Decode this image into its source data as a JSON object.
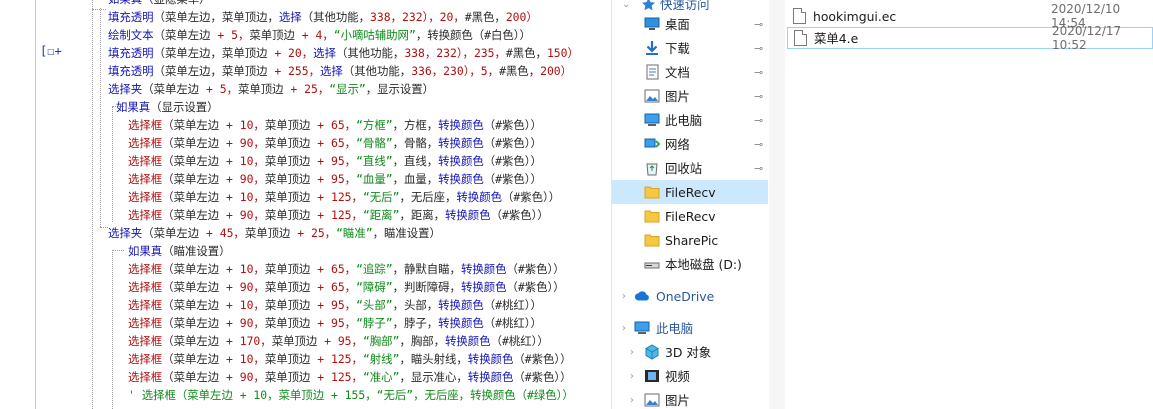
{
  "editor": {
    "breakpoint_marker": "[☐+",
    "lines": [
      [
        {
          "t": "如果真（",
          "c": "c-blue"
        },
        {
          "t": "显隐菜单）",
          "c": "c-dark"
        }
      ],
      [
        {
          "t": "填充透明",
          "c": "c-blue"
        },
        {
          "t": "（菜单左边，菜单顶边，",
          "c": "c-dark"
        },
        {
          "t": "选择",
          "c": "c-blue"
        },
        {
          "t": "（其他功能，",
          "c": "c-dark"
        },
        {
          "t": "338，232），20，",
          "c": "c-red"
        },
        {
          "t": "#黑色，",
          "c": "c-dark"
        },
        {
          "t": "200）",
          "c": "c-red"
        }
      ],
      [
        {
          "t": "绘制文本",
          "c": "c-blue"
        },
        {
          "t": "（菜单左边 ",
          "c": "c-dark"
        },
        {
          "t": "+ 5，",
          "c": "c-red"
        },
        {
          "t": "菜单顶边 ",
          "c": "c-dark"
        },
        {
          "t": "+ 4，",
          "c": "c-red"
        },
        {
          "t": "“小嘀咕辅助网”",
          "c": "c-green"
        },
        {
          "t": "，转换颜色（",
          "c": "c-dark"
        },
        {
          "t": "#白色））",
          "c": "c-dark"
        }
      ],
      [
        {
          "t": "填充透明",
          "c": "c-blue"
        },
        {
          "t": "（菜单左边，菜单顶边 ",
          "c": "c-dark"
        },
        {
          "t": "+ 20，",
          "c": "c-red"
        },
        {
          "t": "选择",
          "c": "c-blue"
        },
        {
          "t": "（其他功能，",
          "c": "c-dark"
        },
        {
          "t": "338，232），235，",
          "c": "c-red"
        },
        {
          "t": "#黑色，",
          "c": "c-dark"
        },
        {
          "t": "150）",
          "c": "c-red"
        }
      ],
      [
        {
          "t": "填充透明",
          "c": "c-blue"
        },
        {
          "t": "（菜单左边，菜单顶边 ",
          "c": "c-dark"
        },
        {
          "t": "+ 255，",
          "c": "c-red"
        },
        {
          "t": "选择",
          "c": "c-blue"
        },
        {
          "t": "（其他功能，",
          "c": "c-dark"
        },
        {
          "t": "336，230），5，",
          "c": "c-red"
        },
        {
          "t": "#黑色，",
          "c": "c-dark"
        },
        {
          "t": "200）",
          "c": "c-red"
        }
      ],
      [
        {
          "t": "选择夹",
          "c": "c-blue"
        },
        {
          "t": "（菜单左边 ",
          "c": "c-dark"
        },
        {
          "t": "+ 5，",
          "c": "c-red"
        },
        {
          "t": "菜单顶边 ",
          "c": "c-dark"
        },
        {
          "t": "+ 25，",
          "c": "c-red"
        },
        {
          "t": "“显示”",
          "c": "c-green"
        },
        {
          "t": "，显示设置）",
          "c": "c-dark"
        }
      ],
      [
        {
          "t": "如果真",
          "c": "c-blue"
        },
        {
          "t": "（显示设置）",
          "c": "c-dark"
        }
      ],
      [
        {
          "t": "选择框",
          "c": "c-red"
        },
        {
          "t": "（菜单左边 ",
          "c": "c-dark"
        },
        {
          "t": "+ 10，",
          "c": "c-red"
        },
        {
          "t": "菜单顶边 ",
          "c": "c-dark"
        },
        {
          "t": "+ 65，",
          "c": "c-red"
        },
        {
          "t": "“方框”",
          "c": "c-green"
        },
        {
          "t": "，方框，",
          "c": "c-dark"
        },
        {
          "t": "转换颜色",
          "c": "c-blue"
        },
        {
          "t": "（#紫色））",
          "c": "c-dark"
        }
      ],
      [
        {
          "t": "选择框",
          "c": "c-red"
        },
        {
          "t": "（菜单左边 ",
          "c": "c-dark"
        },
        {
          "t": "+ 90，",
          "c": "c-red"
        },
        {
          "t": "菜单顶边 ",
          "c": "c-dark"
        },
        {
          "t": "+ 65，",
          "c": "c-red"
        },
        {
          "t": "“骨骼”",
          "c": "c-green"
        },
        {
          "t": "，骨骼，",
          "c": "c-dark"
        },
        {
          "t": "转换颜色",
          "c": "c-blue"
        },
        {
          "t": "（#紫色））",
          "c": "c-dark"
        }
      ],
      [
        {
          "t": "选择框",
          "c": "c-red"
        },
        {
          "t": "（菜单左边 ",
          "c": "c-dark"
        },
        {
          "t": "+ 10，",
          "c": "c-red"
        },
        {
          "t": "菜单顶边 ",
          "c": "c-dark"
        },
        {
          "t": "+ 95，",
          "c": "c-red"
        },
        {
          "t": "“直线”",
          "c": "c-green"
        },
        {
          "t": "，直线，",
          "c": "c-dark"
        },
        {
          "t": "转换颜色",
          "c": "c-blue"
        },
        {
          "t": "（#紫色））",
          "c": "c-dark"
        }
      ],
      [
        {
          "t": "选择框",
          "c": "c-red"
        },
        {
          "t": "（菜单左边 ",
          "c": "c-dark"
        },
        {
          "t": "+ 90，",
          "c": "c-red"
        },
        {
          "t": "菜单顶边 ",
          "c": "c-dark"
        },
        {
          "t": "+ 95，",
          "c": "c-red"
        },
        {
          "t": "“血量”",
          "c": "c-green"
        },
        {
          "t": "，血量，",
          "c": "c-dark"
        },
        {
          "t": "转换颜色",
          "c": "c-blue"
        },
        {
          "t": "（#紫色））",
          "c": "c-dark"
        }
      ],
      [
        {
          "t": "选择框",
          "c": "c-red"
        },
        {
          "t": "（菜单左边 ",
          "c": "c-dark"
        },
        {
          "t": "+ 10，",
          "c": "c-red"
        },
        {
          "t": "菜单顶边 ",
          "c": "c-dark"
        },
        {
          "t": "+ 125，",
          "c": "c-red"
        },
        {
          "t": "“无后”",
          "c": "c-green"
        },
        {
          "t": "，无后座，",
          "c": "c-dark"
        },
        {
          "t": "转换颜色",
          "c": "c-blue"
        },
        {
          "t": "（#紫色））",
          "c": "c-dark"
        }
      ],
      [
        {
          "t": "选择框",
          "c": "c-red"
        },
        {
          "t": "（菜单左边 ",
          "c": "c-dark"
        },
        {
          "t": "+ 90，",
          "c": "c-red"
        },
        {
          "t": "菜单顶边 ",
          "c": "c-dark"
        },
        {
          "t": "+ 125，",
          "c": "c-red"
        },
        {
          "t": "“距离”",
          "c": "c-green"
        },
        {
          "t": "，距离，",
          "c": "c-dark"
        },
        {
          "t": "转换颜色",
          "c": "c-blue"
        },
        {
          "t": "（#紫色））",
          "c": "c-dark"
        }
      ],
      [
        {
          "t": "选择夹",
          "c": "c-blue"
        },
        {
          "t": "（菜单左边 ",
          "c": "c-dark"
        },
        {
          "t": "+ 45，",
          "c": "c-red"
        },
        {
          "t": "菜单顶边 ",
          "c": "c-dark"
        },
        {
          "t": "+ 25，",
          "c": "c-red"
        },
        {
          "t": "“瞄准”",
          "c": "c-green"
        },
        {
          "t": "，瞄准设置）",
          "c": "c-dark"
        }
      ],
      [
        {
          "t": "如果真",
          "c": "c-blue"
        },
        {
          "t": "（瞄准设置）",
          "c": "c-dark"
        }
      ],
      [
        {
          "t": "选择框",
          "c": "c-red"
        },
        {
          "t": "（菜单左边 ",
          "c": "c-dark"
        },
        {
          "t": "+ 10，",
          "c": "c-red"
        },
        {
          "t": "菜单顶边 ",
          "c": "c-dark"
        },
        {
          "t": "+ 65，",
          "c": "c-red"
        },
        {
          "t": "“追踪”",
          "c": "c-green"
        },
        {
          "t": "，静默自瞄，",
          "c": "c-dark"
        },
        {
          "t": "转换颜色",
          "c": "c-blue"
        },
        {
          "t": "（#紫色））",
          "c": "c-dark"
        }
      ],
      [
        {
          "t": "选择框",
          "c": "c-red"
        },
        {
          "t": "（菜单左边 ",
          "c": "c-dark"
        },
        {
          "t": "+ 90，",
          "c": "c-red"
        },
        {
          "t": "菜单顶边 ",
          "c": "c-dark"
        },
        {
          "t": "+ 65，",
          "c": "c-red"
        },
        {
          "t": "“障碍”",
          "c": "c-green"
        },
        {
          "t": "，判断障碍，",
          "c": "c-dark"
        },
        {
          "t": "转换颜色",
          "c": "c-blue"
        },
        {
          "t": "（#紫色））",
          "c": "c-dark"
        }
      ],
      [
        {
          "t": "选择框",
          "c": "c-red"
        },
        {
          "t": "（菜单左边 ",
          "c": "c-dark"
        },
        {
          "t": "+ 10，",
          "c": "c-red"
        },
        {
          "t": "菜单顶边 ",
          "c": "c-dark"
        },
        {
          "t": "+ 95，",
          "c": "c-red"
        },
        {
          "t": "“头部”",
          "c": "c-green"
        },
        {
          "t": "，头部，",
          "c": "c-dark"
        },
        {
          "t": "转换颜色",
          "c": "c-blue"
        },
        {
          "t": "（#桃红））",
          "c": "c-dark"
        }
      ],
      [
        {
          "t": "选择框",
          "c": "c-red"
        },
        {
          "t": "（菜单左边 ",
          "c": "c-dark"
        },
        {
          "t": "+ 90，",
          "c": "c-red"
        },
        {
          "t": "菜单顶边 ",
          "c": "c-dark"
        },
        {
          "t": "+ 95，",
          "c": "c-red"
        },
        {
          "t": "“脖子”",
          "c": "c-green"
        },
        {
          "t": "，脖子，",
          "c": "c-dark"
        },
        {
          "t": "转换颜色",
          "c": "c-blue"
        },
        {
          "t": "（#桃红））",
          "c": "c-dark"
        }
      ],
      [
        {
          "t": "选择框",
          "c": "c-red"
        },
        {
          "t": "（菜单左边 ",
          "c": "c-dark"
        },
        {
          "t": "+ 170，",
          "c": "c-red"
        },
        {
          "t": "菜单顶边 ",
          "c": "c-dark"
        },
        {
          "t": "+ 95，",
          "c": "c-red"
        },
        {
          "t": "“胸部”",
          "c": "c-green"
        },
        {
          "t": "，胸部，",
          "c": "c-dark"
        },
        {
          "t": "转换颜色",
          "c": "c-blue"
        },
        {
          "t": "（#桃红））",
          "c": "c-dark"
        }
      ],
      [
        {
          "t": "选择框",
          "c": "c-red"
        },
        {
          "t": "（菜单左边 ",
          "c": "c-dark"
        },
        {
          "t": "+ 10，",
          "c": "c-red"
        },
        {
          "t": "菜单顶边 ",
          "c": "c-dark"
        },
        {
          "t": "+ 125，",
          "c": "c-red"
        },
        {
          "t": "“射线”",
          "c": "c-green"
        },
        {
          "t": "，瞄头射线，",
          "c": "c-dark"
        },
        {
          "t": "转换颜色",
          "c": "c-blue"
        },
        {
          "t": "（#紫色））",
          "c": "c-dark"
        }
      ],
      [
        {
          "t": "选择框",
          "c": "c-red"
        },
        {
          "t": "（菜单左边 ",
          "c": "c-dark"
        },
        {
          "t": "+ 90，",
          "c": "c-red"
        },
        {
          "t": "菜单顶边 ",
          "c": "c-dark"
        },
        {
          "t": "+ 125，",
          "c": "c-red"
        },
        {
          "t": "“准心”",
          "c": "c-green"
        },
        {
          "t": "，显示准心，",
          "c": "c-dark"
        },
        {
          "t": "转换颜色",
          "c": "c-blue"
        },
        {
          "t": "（#紫色））",
          "c": "c-dark"
        }
      ],
      [
        {
          "t": "' 选择框（菜单左边 + 10，菜单顶边 + 155，“无后”，无后座，转换颜色（#绿色））",
          "c": "c-green"
        }
      ]
    ]
  },
  "nav": {
    "quick_access": "快速访问",
    "items": [
      {
        "label": "桌面",
        "icon": "desktop-icon",
        "pinned": true
      },
      {
        "label": "下载",
        "icon": "download-icon",
        "pinned": true
      },
      {
        "label": "文档",
        "icon": "document-icon",
        "pinned": true
      },
      {
        "label": "图片",
        "icon": "picture-icon",
        "pinned": true
      },
      {
        "label": "此电脑",
        "icon": "computer-icon",
        "pinned": true
      },
      {
        "label": "网络",
        "icon": "network-icon",
        "pinned": true
      },
      {
        "label": "回收站",
        "icon": "recycle-bin-icon",
        "pinned": true
      },
      {
        "label": "FileRecv",
        "icon": "folder-icon",
        "pinned": false,
        "selected": true
      },
      {
        "label": "FileRecv",
        "icon": "folder-icon",
        "pinned": false
      },
      {
        "label": "SharePic",
        "icon": "folder-icon",
        "pinned": false
      },
      {
        "label": "本地磁盘 (D:)",
        "icon": "drive-icon",
        "pinned": false
      },
      {
        "label": "OneDrive",
        "icon": "onedrive-icon",
        "pinned": false,
        "group": true
      },
      {
        "label": "此电脑",
        "icon": "computer-icon",
        "pinned": false,
        "group": true
      },
      {
        "label": "3D 对象",
        "icon": "3d-objects-icon",
        "pinned": false
      },
      {
        "label": "视频",
        "icon": "video-icon",
        "pinned": false
      },
      {
        "label": "图片",
        "icon": "picture-icon",
        "pinned": false
      }
    ]
  },
  "files": [
    {
      "name": "hookimgui.ec",
      "date": "2020/12/10 14:54",
      "selected": false
    },
    {
      "name": "菜单4.e",
      "date": "2020/12/17 10:52",
      "selected": true
    }
  ],
  "colors": {
    "keyword": "#1414b4",
    "string": "#0f8a1a",
    "number": "#b00f0f",
    "selection": "#cce8ff"
  }
}
